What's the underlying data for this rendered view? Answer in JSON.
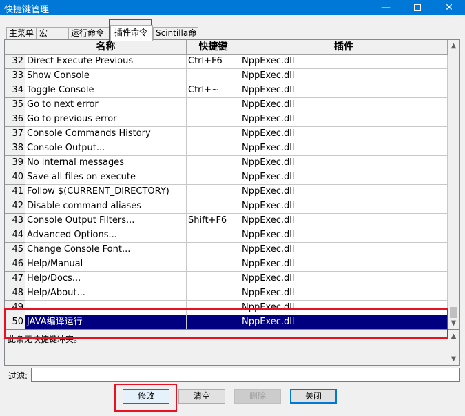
{
  "window": {
    "title": "快捷键管理",
    "minimize_glyph": "—",
    "close_glyph": "✕"
  },
  "tabs": [
    {
      "label": "主菜单"
    },
    {
      "label": "宏"
    },
    {
      "label": "运行命令"
    },
    {
      "label": "插件命令",
      "active": true
    },
    {
      "label": "Scintilla命令"
    }
  ],
  "table": {
    "columns": [
      "名称",
      "快捷键",
      "插件"
    ],
    "rows": [
      {
        "num": "32",
        "name": "Direct Execute Previous",
        "shortcut": "Ctrl+F6",
        "plugin": "NppExec.dll"
      },
      {
        "num": "33",
        "name": "Show Console",
        "shortcut": "",
        "plugin": "NppExec.dll"
      },
      {
        "num": "34",
        "name": "Toggle Console",
        "shortcut": "Ctrl+~",
        "plugin": "NppExec.dll"
      },
      {
        "num": "35",
        "name": "Go to next error",
        "shortcut": "",
        "plugin": "NppExec.dll"
      },
      {
        "num": "36",
        "name": "Go to previous error",
        "shortcut": "",
        "plugin": "NppExec.dll"
      },
      {
        "num": "37",
        "name": "Console Commands History",
        "shortcut": "",
        "plugin": "NppExec.dll"
      },
      {
        "num": "38",
        "name": "Console Output...",
        "shortcut": "",
        "plugin": "NppExec.dll"
      },
      {
        "num": "39",
        "name": "No internal messages",
        "shortcut": "",
        "plugin": "NppExec.dll"
      },
      {
        "num": "40",
        "name": "Save all files on execute",
        "shortcut": "",
        "plugin": "NppExec.dll"
      },
      {
        "num": "41",
        "name": "Follow $(CURRENT_DIRECTORY)",
        "shortcut": "",
        "plugin": "NppExec.dll"
      },
      {
        "num": "42",
        "name": "Disable command aliases",
        "shortcut": "",
        "plugin": "NppExec.dll"
      },
      {
        "num": "43",
        "name": "Console Output Filters...",
        "shortcut": "Shift+F6",
        "plugin": "NppExec.dll"
      },
      {
        "num": "44",
        "name": "Advanced Options...",
        "shortcut": "",
        "plugin": "NppExec.dll"
      },
      {
        "num": "45",
        "name": "Change Console Font...",
        "shortcut": "",
        "plugin": "NppExec.dll"
      },
      {
        "num": "46",
        "name": "Help/Manual",
        "shortcut": "",
        "plugin": "NppExec.dll"
      },
      {
        "num": "47",
        "name": "Help/Docs...",
        "shortcut": "",
        "plugin": "NppExec.dll"
      },
      {
        "num": "48",
        "name": "Help/About...",
        "shortcut": "",
        "plugin": "NppExec.dll"
      },
      {
        "num": "49",
        "name": "",
        "shortcut": "",
        "plugin": "NppExec.dll"
      },
      {
        "num": "50",
        "name": "JAVA编译运行",
        "shortcut": "",
        "plugin": "NppExec.dll",
        "selected": true
      }
    ]
  },
  "info": {
    "text": "此条无快捷键冲突。"
  },
  "filter": {
    "label": "过滤:",
    "value": ""
  },
  "buttons": {
    "modify": "修改",
    "clear": "清空",
    "delete": "删除",
    "close": "关闭"
  },
  "colors": {
    "selection": "#000080",
    "highlight_box": "#e81123",
    "titlebar": "#0078d7"
  }
}
